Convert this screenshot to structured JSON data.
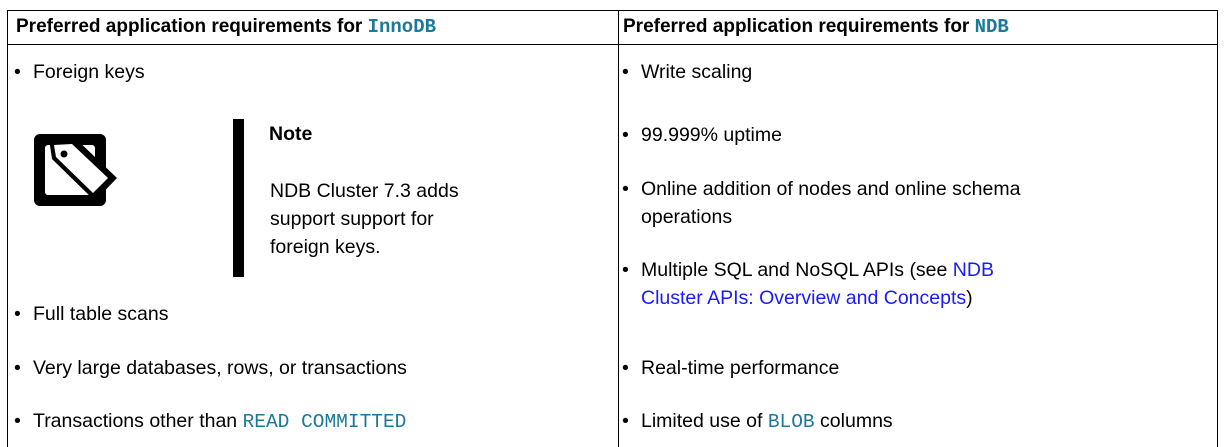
{
  "header": {
    "left_prefix": "Preferred application requirements for ",
    "left_code": "InnoDB",
    "right_prefix": "Preferred application requirements for ",
    "right_code": "NDB"
  },
  "left_items": {
    "foreign_keys": "Foreign keys",
    "full_table_scans": "Full table scans",
    "very_large": "Very large databases, rows, or transactions",
    "transactions_prefix": "Transactions other than ",
    "transactions_code": "READ COMMITTED"
  },
  "note": {
    "title": "Note",
    "body_line1": "NDB Cluster 7.3 adds",
    "body_line2": "support support for",
    "body_line3": "foreign keys.",
    "icon": "note-tag-icon"
  },
  "right_items": {
    "write_scaling": "Write scaling",
    "uptime": "99.999% uptime",
    "online_line1": "Online addition of nodes and online schema",
    "online_line2": "operations",
    "apis_prefix": "Multiple SQL and NoSQL APIs (see ",
    "apis_link_line1": "NDB",
    "apis_link_line2": "Cluster APIs: Overview and Concepts",
    "apis_suffix": ")",
    "realtime": "Real-time performance",
    "blob_prefix": "Limited use of ",
    "blob_code": "BLOB",
    "blob_suffix": " columns"
  },
  "bullet": "•",
  "colors": {
    "code": "#1b7a9a",
    "link": "#1a1aff"
  }
}
